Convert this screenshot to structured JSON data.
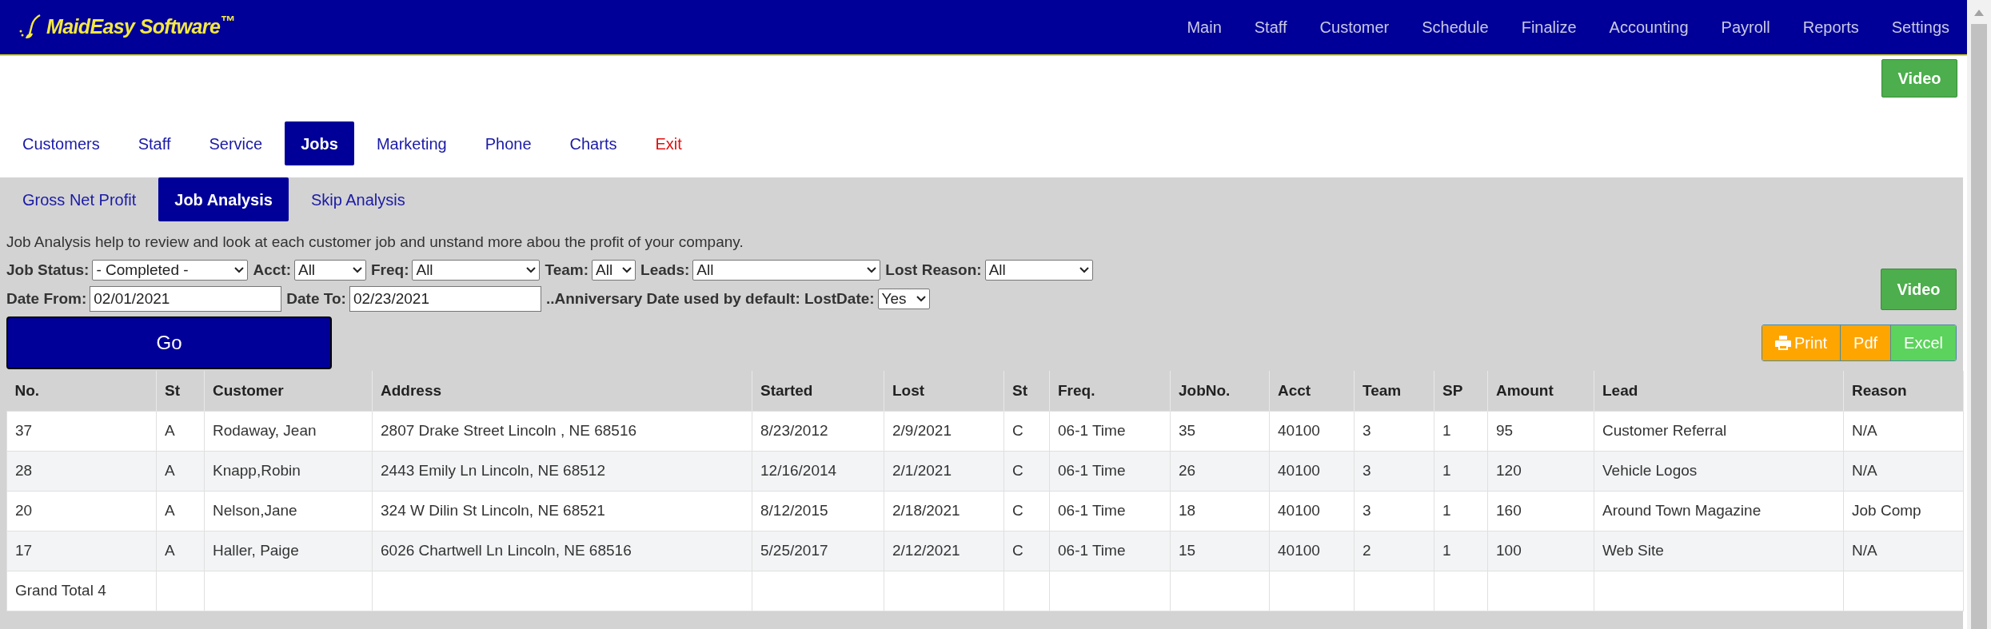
{
  "header": {
    "logo": "MaidEasy Software$^{™}$",
    "nav": [
      "Main",
      "Staff",
      "Customer",
      "Schedule",
      "Finalize",
      "Accounting",
      "Payroll",
      "Reports",
      "Settings"
    ]
  },
  "top_video_button": "Video",
  "tabs": [
    {
      "label": "Customers",
      "selected": false,
      "kind": "normal"
    },
    {
      "label": "Staff",
      "selected": false,
      "kind": "normal"
    },
    {
      "label": "Service",
      "selected": false,
      "kind": "normal"
    },
    {
      "label": "Jobs",
      "selected": true,
      "kind": "normal"
    },
    {
      "label": "Marketing",
      "selected": false,
      "kind": "normal"
    },
    {
      "label": "Phone",
      "selected": false,
      "kind": "normal"
    },
    {
      "label": "Charts",
      "selected": false,
      "kind": "normal"
    },
    {
      "label": "Exit",
      "selected": false,
      "kind": "exit"
    }
  ],
  "subtabs": [
    {
      "label": "Gross Net Profit",
      "selected": false
    },
    {
      "label": "Job Analysis",
      "selected": true
    },
    {
      "label": "Skip Analysis",
      "selected": false
    }
  ],
  "description": "Job Analysis help to review and look at each customer job and unstand more abou the profit of your company.",
  "filter_rows": [
    [
      {
        "label": "Job Status:",
        "kind": "select",
        "value": "- Completed -"
      },
      {
        "label": "Acct:",
        "kind": "select",
        "value": "All"
      },
      {
        "label": "Freq:",
        "kind": "select",
        "value": "All"
      },
      {
        "label": "Team:",
        "kind": "select",
        "value": "All"
      },
      {
        "label": "Leads:",
        "kind": "select",
        "value": "All"
      },
      {
        "label": "Lost Reason:",
        "kind": "select",
        "value": "All"
      }
    ],
    [
      {
        "label": "Date From:",
        "kind": "input",
        "value": "02/01/2021"
      },
      {
        "label": "Date To:",
        "kind": "input",
        "value": "02/23/2021"
      },
      {
        "label": "..Anniversary Date used by default: LostDate:",
        "kind": "select",
        "value": "Yes"
      }
    ]
  ],
  "go_button": "Go",
  "side_video_button": "Video",
  "export_buttons": [
    {
      "label": "Print",
      "kind": "print",
      "color": "#ffa500"
    },
    {
      "label": "Pdf",
      "kind": "plain",
      "color": "#ffa500"
    },
    {
      "label": "Excel",
      "kind": "plain",
      "color": "#5cd35c"
    }
  ],
  "table": {
    "columns": [
      "No.",
      "St",
      "Customer",
      "Address",
      "Started",
      "Lost",
      "St",
      "Freq.",
      "JobNo.",
      "Acct",
      "Team",
      "SP",
      "Amount",
      "Lead",
      "Reason"
    ],
    "rows": [
      [
        "37",
        "A",
        "Rodaway, Jean",
        "2807 Drake Street Lincoln , NE 68516",
        "8/23/2012",
        "2/9/2021",
        "C",
        "06-1 Time",
        "35",
        "40100",
        "3",
        "1",
        "95",
        "Customer Referral",
        "N/A"
      ],
      [
        "28",
        "A",
        "Knapp,Robin",
        "2443 Emily Ln Lincoln, NE 68512",
        "12/16/2014",
        "2/1/2021",
        "C",
        "06-1 Time",
        "26",
        "40100",
        "3",
        "1",
        "120",
        "Vehicle Logos",
        "N/A"
      ],
      [
        "20",
        "A",
        "Nelson,Jane",
        "324 W Dilin St Lincoln, NE 68521",
        "8/12/2015",
        "2/18/2021",
        "C",
        "06-1 Time",
        "18",
        "40100",
        "3",
        "1",
        "160",
        "Around Town Magazine",
        "Job Comp"
      ],
      [
        "17",
        "A",
        "Haller, Paige",
        "6026 Chartwell Ln Lincoln, NE 68516",
        "5/25/2017",
        "2/12/2021",
        "C",
        "06-1 Time",
        "15",
        "40100",
        "2",
        "1",
        "100",
        "Web Site",
        "N/A"
      ]
    ],
    "footer": "Grand Total 4"
  }
}
